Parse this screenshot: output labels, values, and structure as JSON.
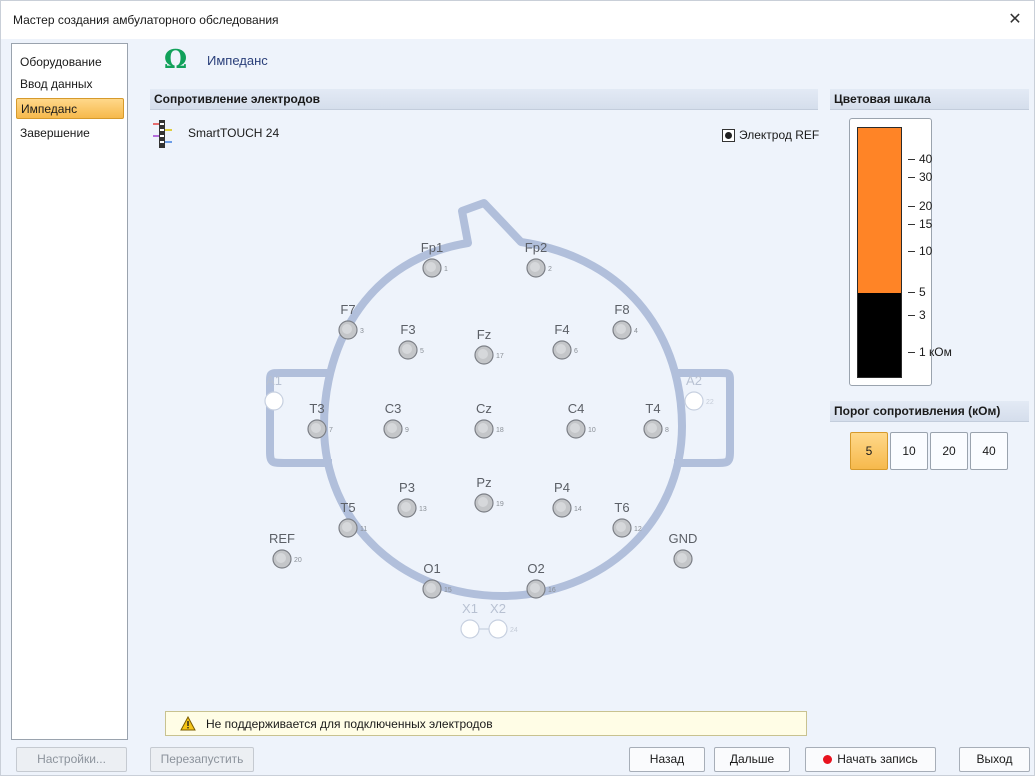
{
  "window": {
    "title": "Мастер создания амбулаторного обследования",
    "close_symbol": "✕"
  },
  "sidebar": {
    "items": [
      {
        "label": "Оборудование",
        "active": false
      },
      {
        "label": "Ввод данных",
        "active": false
      },
      {
        "label": "Импеданс",
        "active": true
      },
      {
        "label": "Завершение",
        "active": false
      }
    ]
  },
  "header": {
    "icon": "omega-icon",
    "icon_glyph": "Ω",
    "title": "Импеданс",
    "accent_color": "#11a15a"
  },
  "electrodes_section": {
    "title": "Сопротивление электродов",
    "device_name": "SmartTOUCH 24",
    "ref_checkbox_label": "Электрод REF",
    "ref_checked": true
  },
  "electrodes": [
    {
      "name": "Fp1",
      "num": "1"
    },
    {
      "name": "Fp2",
      "num": "2"
    },
    {
      "name": "F7",
      "num": "3"
    },
    {
      "name": "F3",
      "num": "5"
    },
    {
      "name": "Fz",
      "num": "17"
    },
    {
      "name": "F4",
      "num": "6"
    },
    {
      "name": "F8",
      "num": "4"
    },
    {
      "name": "A1",
      "num": "",
      "faded": true
    },
    {
      "name": "T3",
      "num": "7"
    },
    {
      "name": "C3",
      "num": "9"
    },
    {
      "name": "Cz",
      "num": "18"
    },
    {
      "name": "C4",
      "num": "10"
    },
    {
      "name": "T4",
      "num": "8"
    },
    {
      "name": "A2",
      "num": "22",
      "faded": true
    },
    {
      "name": "P3",
      "num": "13"
    },
    {
      "name": "Pz",
      "num": "19"
    },
    {
      "name": "P4",
      "num": "14"
    },
    {
      "name": "T5",
      "num": "11"
    },
    {
      "name": "T6",
      "num": "12"
    },
    {
      "name": "REF",
      "num": "20"
    },
    {
      "name": "GND",
      "num": ""
    },
    {
      "name": "O1",
      "num": "15"
    },
    {
      "name": "O2",
      "num": "16"
    },
    {
      "name": "X1",
      "num": "",
      "faded": true
    },
    {
      "name": "X2",
      "num": "24",
      "faded": true
    }
  ],
  "warning": {
    "text": "Не поддерживается для подключенных электродов"
  },
  "color_scale": {
    "title": "Цветовая шкала",
    "ticks": [
      "40",
      "30",
      "20",
      "15",
      "10",
      "5",
      "3",
      "1 кОм"
    ],
    "colors": {
      "high": "#ff8426",
      "low": "#000000"
    }
  },
  "threshold": {
    "title": "Порог сопротивления (кОм)",
    "options": [
      "5",
      "10",
      "20",
      "40"
    ],
    "selected": "5"
  },
  "buttons": {
    "settings": "Настройки...",
    "restart": "Перезапустить",
    "back": "Назад",
    "next": "Дальше",
    "start_record": "Начать запись",
    "exit": "Выход"
  }
}
